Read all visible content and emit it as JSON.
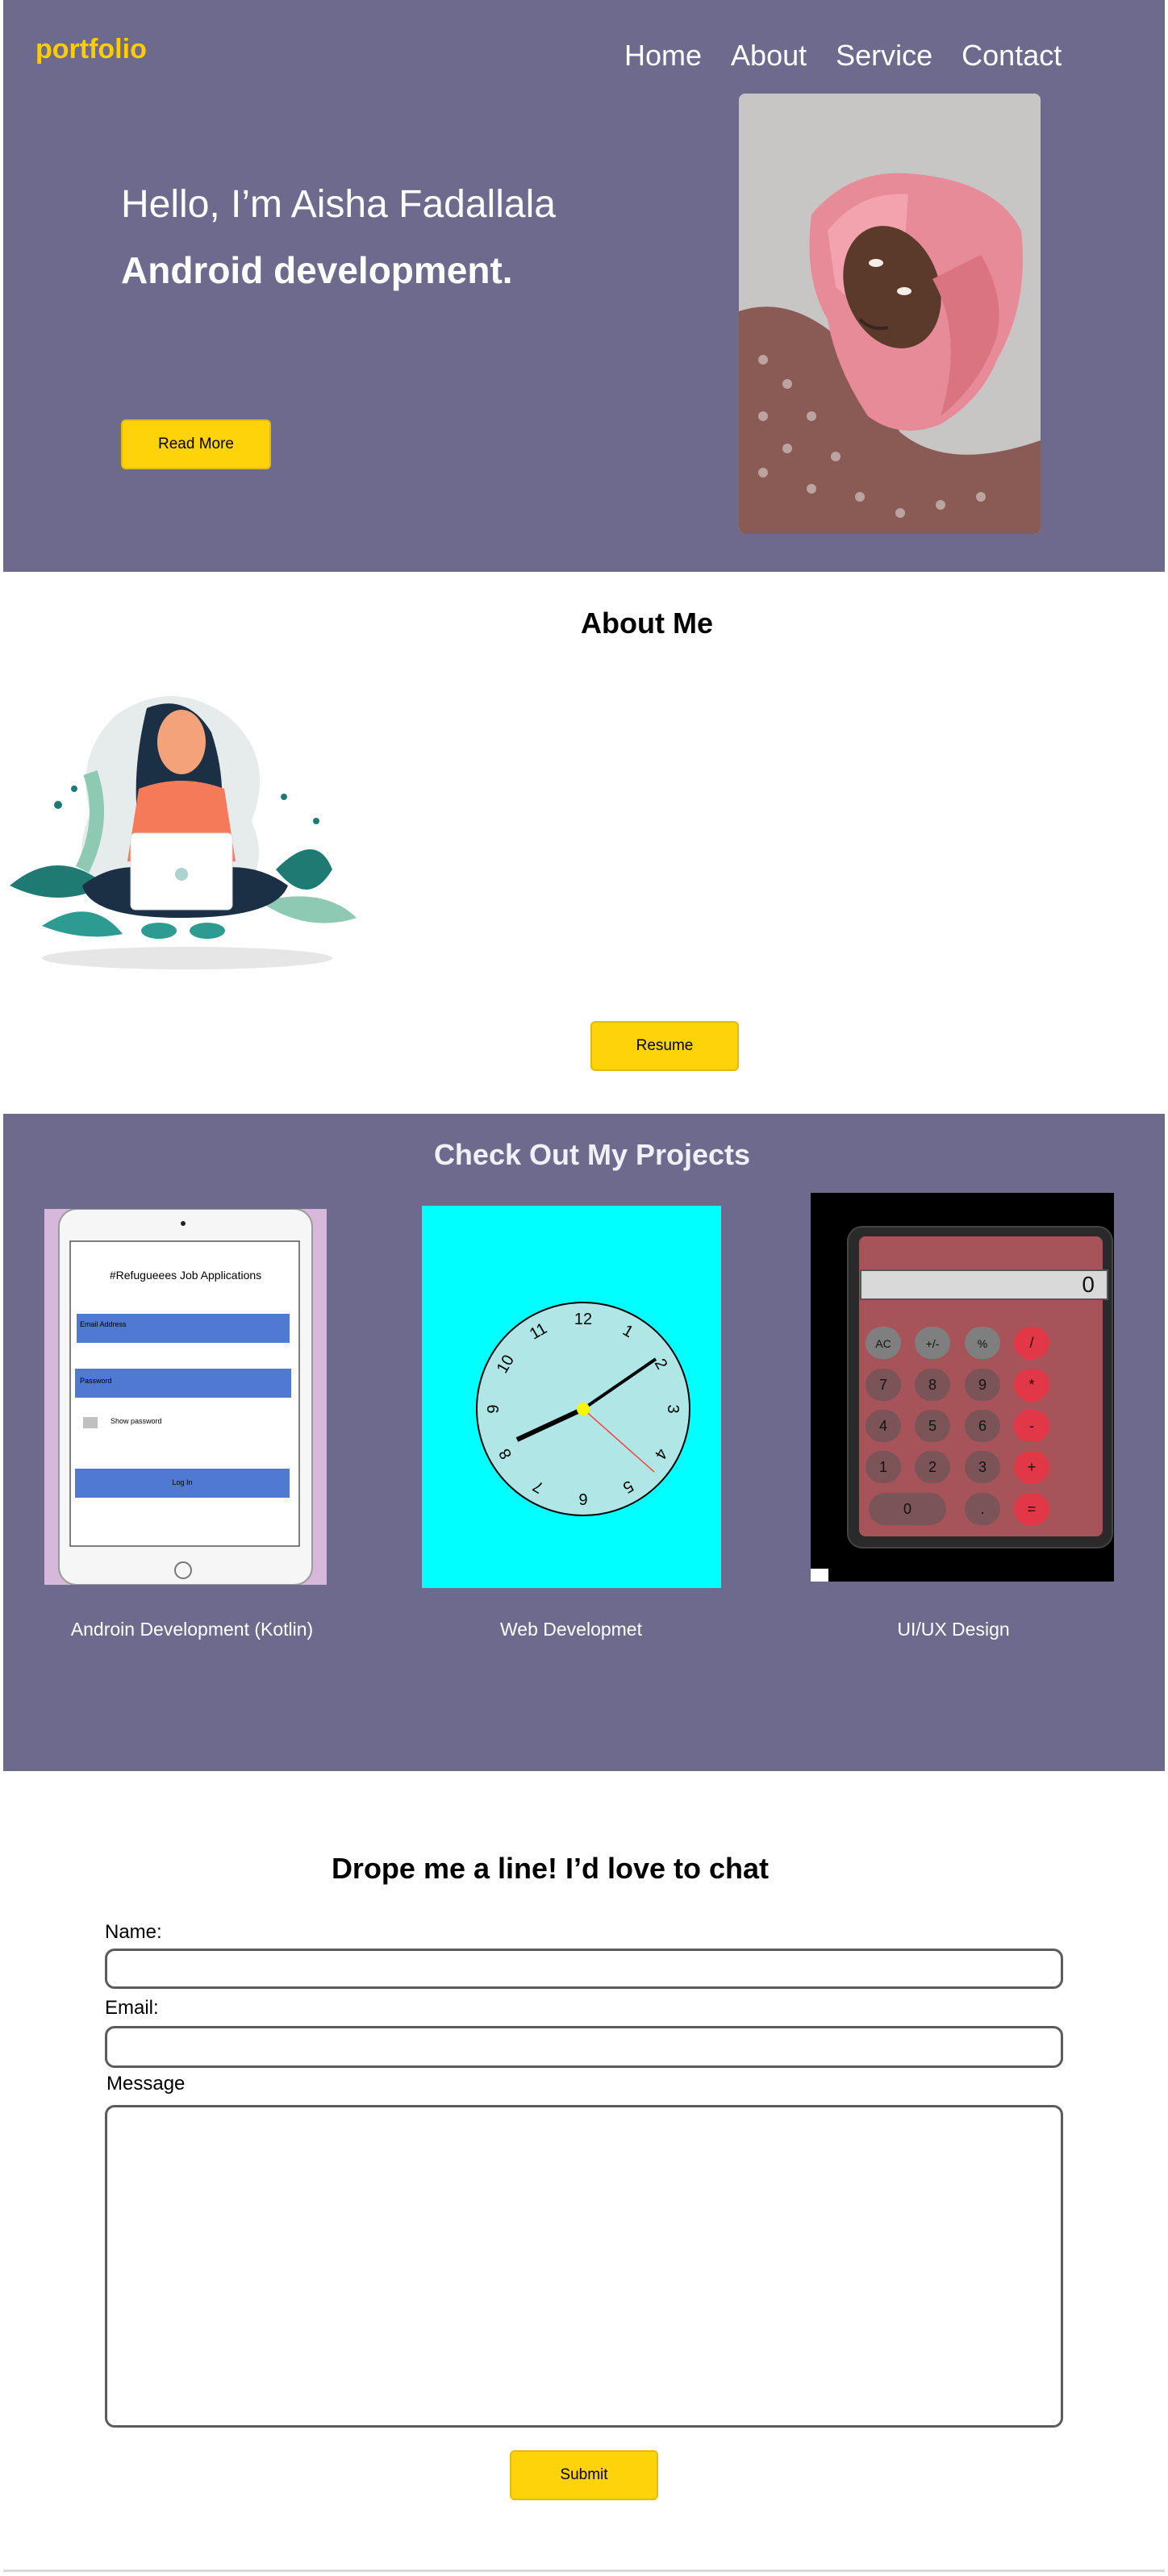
{
  "header": {
    "logo": "portfolio",
    "nav": [
      "Home",
      "About",
      "Service",
      "Contact"
    ]
  },
  "hero": {
    "greeting": "Hello, I’m Aisha Fadallala",
    "role": "Android development.",
    "read_more_label": "Read More"
  },
  "about": {
    "title": "About Me",
    "resume_label": "Resume"
  },
  "projects": {
    "title": "Check Out My Projects",
    "items": [
      {
        "caption": "Androin Development (Kotlin)",
        "screen_title": "#Refugueees Job Applications",
        "email_label": "Email Address",
        "password_label": "Password",
        "show_password": "Show password",
        "login": "Log In"
      },
      {
        "caption": "Web Developmet",
        "clock_numbers": [
          "12",
          "1",
          "2",
          "3",
          "4",
          "5",
          "6",
          "7",
          "8",
          "9",
          "10",
          "11"
        ]
      },
      {
        "caption": "UI/UX Design",
        "display": "0",
        "keys": [
          "AC",
          "+/-",
          "%",
          "/",
          "7",
          "8",
          "9",
          "*",
          "4",
          "5",
          "6",
          "-",
          "1",
          "2",
          "3",
          "+",
          "0",
          ".",
          "="
        ]
      }
    ]
  },
  "contact": {
    "title": "Drope me a line! I’d love to chat",
    "name_label": "Name:",
    "email_label": "Email:",
    "message_label": "Message",
    "name_value": "",
    "email_value": "",
    "message_value": "",
    "submit_label": "Submit"
  },
  "colors": {
    "hero_bg": "#6e6a8e",
    "accent": "#ffd30a",
    "field_primary": "#4f79d2",
    "clock_bg": "#00ffff",
    "clock_face": "#b0e6e6"
  }
}
